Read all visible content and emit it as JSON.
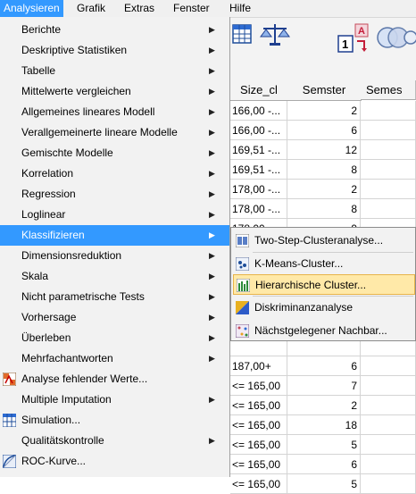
{
  "menubar": {
    "items": [
      {
        "label": "Analysieren",
        "active": true
      },
      {
        "label": "Grafik"
      },
      {
        "label": "Extras"
      },
      {
        "label": "Fenster"
      },
      {
        "label": "Hilfe"
      }
    ]
  },
  "toolbar": {
    "icons": [
      "table-grid-icon",
      "balance-scale-icon",
      "value-labels-icon",
      "circles-icon"
    ]
  },
  "grid": {
    "headers": [
      "Size_cl",
      "Semster",
      "Semes"
    ],
    "rows": [
      [
        "166,00 -...",
        "2"
      ],
      [
        "166,00 -...",
        "6"
      ],
      [
        "169,51 -...",
        "12"
      ],
      [
        "169,51 -...",
        "8"
      ],
      [
        "178,00 -...",
        "2"
      ],
      [
        "178,00 -...",
        "8"
      ],
      [
        "178,00 -...",
        "9"
      ],
      [
        "",
        ""
      ],
      [
        "",
        ""
      ],
      [
        "",
        ""
      ],
      [
        "",
        ""
      ],
      [
        "",
        ""
      ],
      [
        "",
        ""
      ],
      [
        "187,00+",
        "6"
      ],
      [
        "<= 165,00",
        "7"
      ],
      [
        "<= 165,00",
        "2"
      ],
      [
        "<= 165,00",
        "18"
      ],
      [
        "<= 165,00",
        "5"
      ],
      [
        "<= 165,00",
        "6"
      ],
      [
        "<= 165,00",
        "5"
      ]
    ]
  },
  "main_menu": {
    "items": [
      {
        "label": "Berichte",
        "submenu": true
      },
      {
        "label": "Deskriptive Statistiken",
        "submenu": true
      },
      {
        "label": "Tabelle",
        "submenu": true
      },
      {
        "label": "Mittelwerte vergleichen",
        "submenu": true
      },
      {
        "label": "Allgemeines lineares Modell",
        "submenu": true
      },
      {
        "label": "Verallgemeinerte lineare Modelle",
        "submenu": true
      },
      {
        "label": "Gemischte Modelle",
        "submenu": true
      },
      {
        "label": "Korrelation",
        "submenu": true
      },
      {
        "label": "Regression",
        "submenu": true
      },
      {
        "label": "Loglinear",
        "submenu": true
      },
      {
        "label": "Klassifizieren",
        "submenu": true,
        "highlighted": true
      },
      {
        "label": "Dimensionsreduktion",
        "submenu": true
      },
      {
        "label": "Skala",
        "submenu": true
      },
      {
        "label": "Nicht parametrische Tests",
        "submenu": true
      },
      {
        "label": "Vorhersage",
        "submenu": true
      },
      {
        "label": "Überleben",
        "submenu": true
      },
      {
        "label": "Mehrfachantworten",
        "submenu": true
      },
      {
        "label": "Analyse fehlender Werte...",
        "icon": "missing-values-icon"
      },
      {
        "label": "Multiple Imputation",
        "submenu": true
      },
      {
        "label": "Simulation...",
        "icon": "simulation-grid-icon"
      },
      {
        "label": "Qualitätskontrolle",
        "submenu": true
      },
      {
        "label": "ROC-Kurve...",
        "icon": "roc-curve-icon"
      }
    ]
  },
  "submenu": {
    "items": [
      {
        "label": "Two-Step-Clusteranalyse...",
        "icon": "two-step-cluster-icon"
      },
      {
        "label": "K-Means-Cluster...",
        "icon": "k-means-icon"
      },
      {
        "label": "Hierarchische Cluster...",
        "icon": "hierarchical-cluster-icon",
        "highlighted": true
      },
      {
        "label": "Diskriminanzanalyse",
        "icon": "discriminant-icon"
      },
      {
        "label": "Nächstgelegener Nachbar...",
        "icon": "nearest-neighbor-icon"
      }
    ]
  },
  "colors": {
    "menu_highlight": "#3399ff",
    "submenu_highlight": "#ffe9a8"
  }
}
